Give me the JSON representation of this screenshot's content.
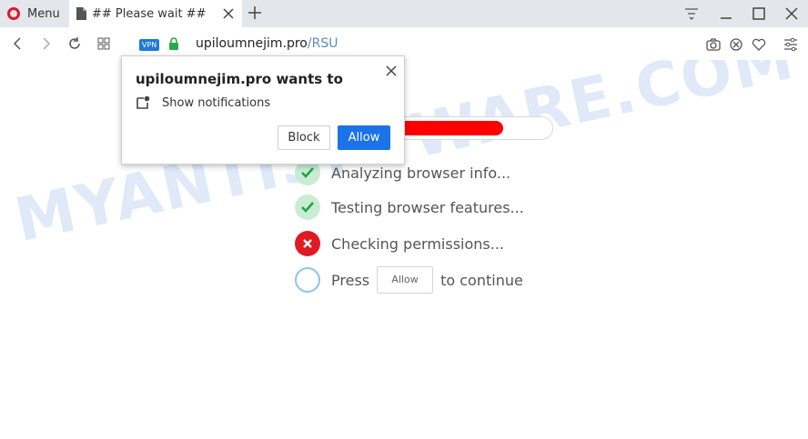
{
  "browser": {
    "menu_label": "Menu",
    "tab_title": "## Please wait ##",
    "vpn_label": "VPN",
    "url_host": "upiloumnejim.pro",
    "url_path": "/RSU"
  },
  "permission_popup": {
    "title": "upiloumnejim.pro wants to",
    "permission_text": "Show notifications",
    "block_label": "Block",
    "allow_label": "Allow"
  },
  "page": {
    "progress_fraction": 0.74,
    "progress_color": "#ff0000",
    "steps": [
      {
        "status": "done",
        "text": "Analyzing browser info..."
      },
      {
        "status": "done",
        "text": "Testing browser features..."
      },
      {
        "status": "error",
        "text": "Checking permissions..."
      }
    ],
    "final_step": {
      "prefix": "Press",
      "button_label": "Allow",
      "suffix": "to continue"
    },
    "watermark": "MYANTISPYWARE.COM"
  },
  "colors": {
    "accent": "#1a73e8",
    "opera_red": "#e0162b",
    "success_bg": "#c9ecd2",
    "error": "#e01a22"
  }
}
